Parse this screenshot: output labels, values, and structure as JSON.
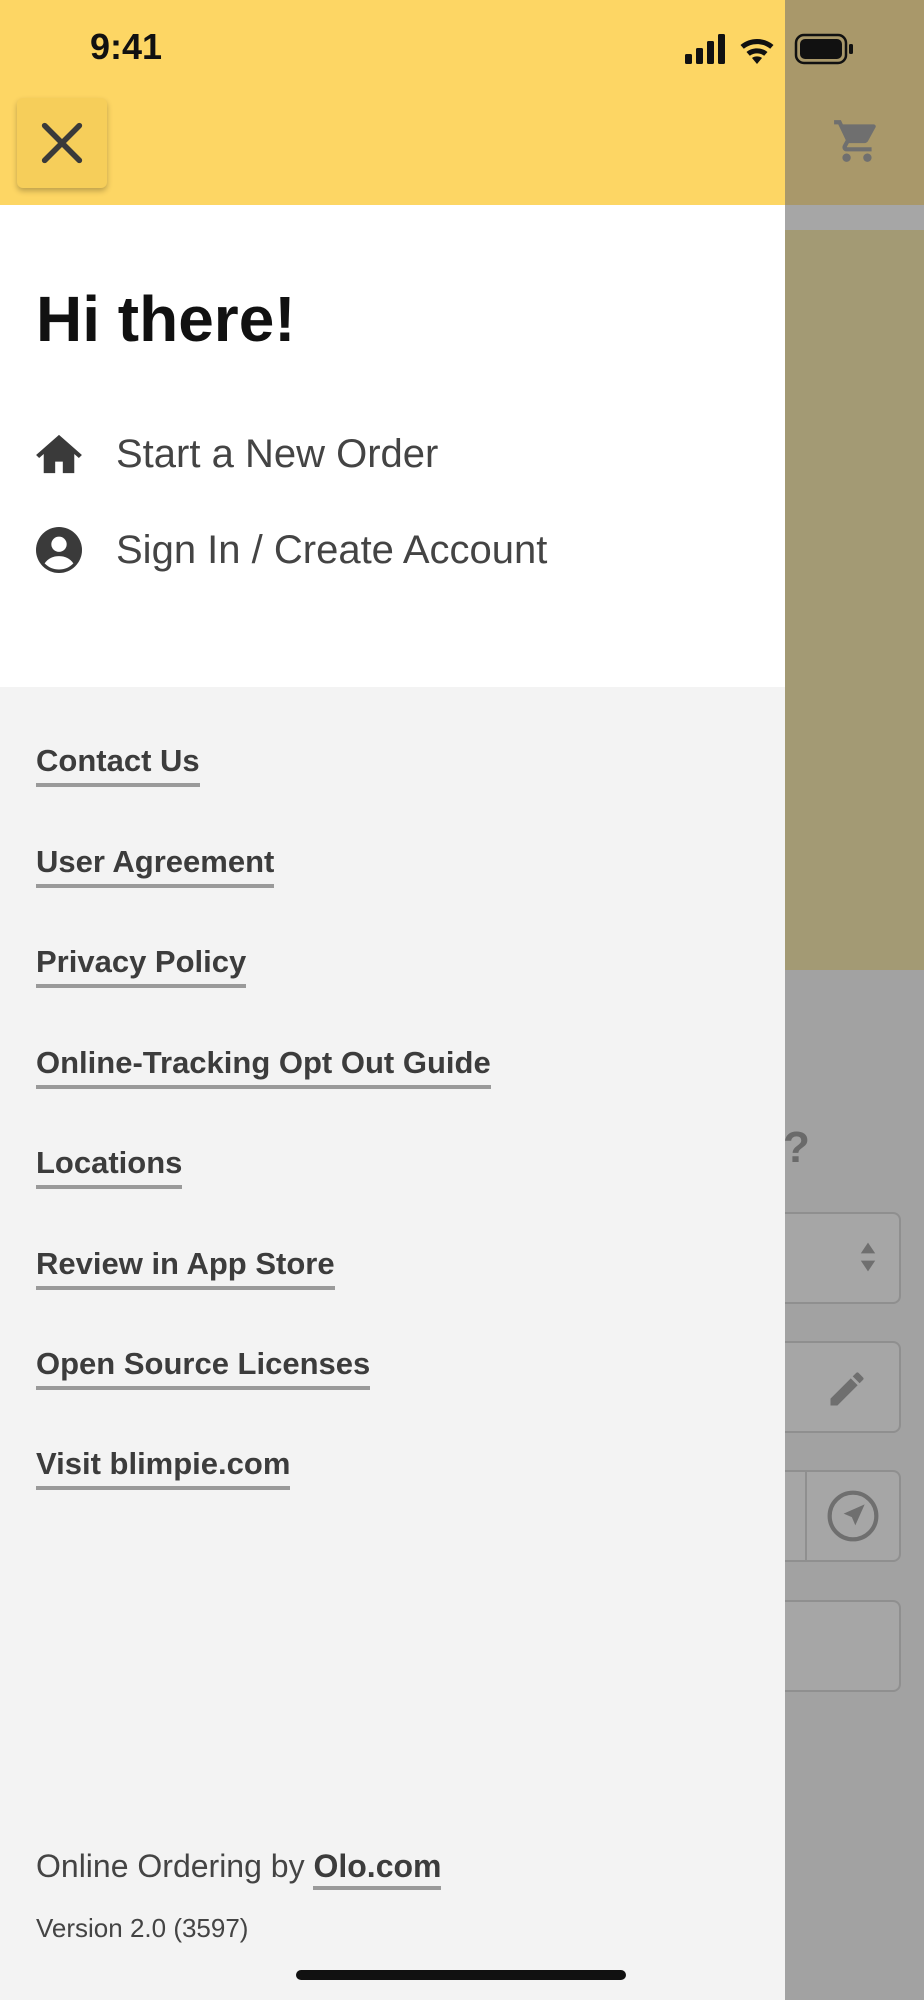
{
  "status_bar": {
    "time": "9:41"
  },
  "drawer": {
    "greeting": "Hi there!",
    "menu": [
      {
        "label": "Start a New Order",
        "icon": "home-icon"
      },
      {
        "label": "Sign In / Create Account",
        "icon": "account-circle-icon"
      }
    ],
    "links": [
      "Contact Us",
      "User Agreement",
      "Privacy Policy",
      "Online-Tracking Opt Out Guide",
      "Locations",
      "Review in App Store",
      "Open Source Licenses",
      "Visit blimpie.com"
    ],
    "footer": {
      "prefix": "Online Ordering by ",
      "link": "Olo.com",
      "version": "Version 2.0 (3597)"
    }
  },
  "background": {
    "question_mark": "?"
  },
  "colors": {
    "header_yellow": "#fdd664",
    "drawer_bg": "#f3f3f3"
  }
}
